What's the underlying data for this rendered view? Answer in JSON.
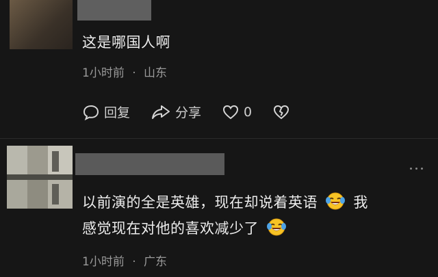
{
  "comment1": {
    "text": "这是哪国人啊",
    "time": "1小时前",
    "location": "山东",
    "separator": "·"
  },
  "actions": {
    "reply_label": "回复",
    "share_label": "分享",
    "like_count": "0"
  },
  "comment2": {
    "text_line1": "以前演的全是英雄，现在却说着英语",
    "text_line1b": "我",
    "text_line2": "感觉现在对他的喜欢减少了",
    "time": "1小时前",
    "location": "广东",
    "separator": "·"
  },
  "icons": {
    "reply": "comment-bubble-icon",
    "share": "share-arrow-icon",
    "like": "heart-icon",
    "dislike": "broken-heart-icon",
    "emoji": "laughing-tears-emoji",
    "more": "more-dots-icon"
  }
}
